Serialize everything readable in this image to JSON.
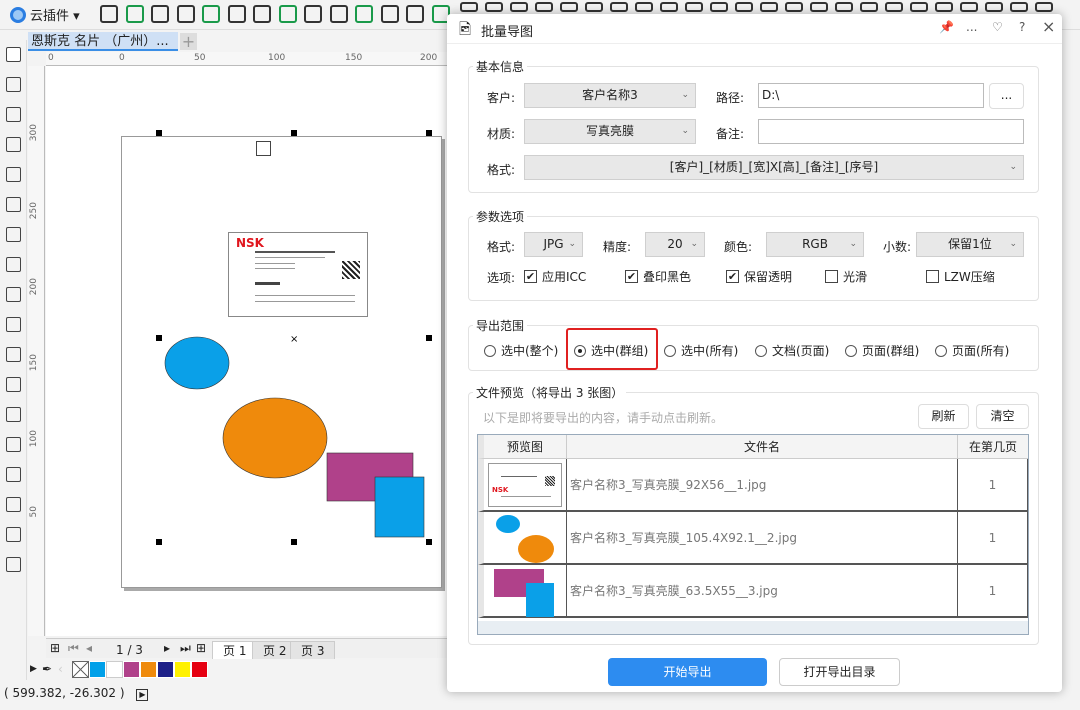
{
  "app": {
    "plugin_menu": "云插件 ▾",
    "toolbar_icons": [
      "image-icon",
      "k-logo-icon",
      "node-icon",
      "book-icon",
      "text-frame-icon",
      "text-tool-icon",
      "text-style-icon",
      "artistic-text-icon",
      "frame-icon",
      "replace-icon",
      "grid-icon",
      "select-box-icon",
      "search-icon",
      "pencil-icon"
    ]
  },
  "document": {
    "tab_title": "恩斯克 名片 （广州）...",
    "add_tab": "+"
  },
  "ruler": {
    "h_labels": [
      "0",
      "0",
      "50",
      "100",
      "150",
      "200"
    ],
    "v_labels": [
      "300",
      "250",
      "200",
      "150",
      "100",
      "50"
    ]
  },
  "toolbox": {
    "icons": [
      "pointer-icon",
      "node-edit-icon",
      "crop-icon",
      "zoom-icon",
      "freehand-icon",
      "curve-icon",
      "rectangle-icon",
      "ellipse-icon",
      "polygon-icon",
      "text-icon",
      "line-icon",
      "connector-icon",
      "shadow-icon",
      "fill-icon",
      "eyedropper-icon",
      "interactive-fill-icon",
      "smart-fill-icon",
      "add-icon"
    ]
  },
  "card": {
    "brand": "NSK"
  },
  "shapes": {
    "colors": {
      "blue": "#0aa0e8",
      "orange": "#ef8a0c",
      "purple": "#b0418a"
    }
  },
  "pagenav": {
    "counter": "1 / 3",
    "tabs": [
      "页 1",
      "页 2",
      "页 3"
    ]
  },
  "palette": {
    "colors": [
      "#00a0e9",
      "#ffffff",
      "#b0418a",
      "#ef8a0c",
      "#1d2088",
      "#fff100",
      "#e60012"
    ]
  },
  "status": {
    "coords": "( 599.382, -26.302 )"
  },
  "dialog": {
    "title": "批量导图",
    "title_icons": [
      "pin-icon",
      "more-icon",
      "heart-icon",
      "help-icon",
      "close-icon"
    ],
    "more": "...",
    "help": "?",
    "close": "×",
    "basic": {
      "legend": "基本信息",
      "customer_label": "客户:",
      "customer_value": "客户名称3",
      "path_label": "路径:",
      "path_value": "D:\\",
      "browse": "...",
      "material_label": "材质:",
      "material_value": "写真亮膜",
      "note_label": "备注:",
      "note_value": "",
      "format_label": "格式:",
      "format_value": "[客户]_[材质]_[宽]X[高]_[备注]_[序号]"
    },
    "params": {
      "legend": "参数选项",
      "format_label": "格式:",
      "format_value": "JPG",
      "precision_label": "精度:",
      "precision_value": "20",
      "color_label": "颜色:",
      "color_value": "RGB",
      "decimal_label": "小数:",
      "decimal_value": "保留1位",
      "options_label": "选项:",
      "options": [
        {
          "label": "应用ICC",
          "checked": true
        },
        {
          "label": "叠印黑色",
          "checked": true
        },
        {
          "label": "保留透明",
          "checked": true
        },
        {
          "label": "光滑",
          "checked": false
        },
        {
          "label": "LZW压缩",
          "checked": false
        }
      ]
    },
    "range": {
      "legend": "导出范围",
      "options": [
        "选中(整个)",
        "选中(群组)",
        "选中(所有)",
        "文档(页面)",
        "页面(群组)",
        "页面(所有)"
      ],
      "selected": 1,
      "highlight_color": "#e02020"
    },
    "preview": {
      "legend": "文件预览（将导出 3 张图）",
      "hint": "以下是即将要导出的内容，请手动点击刷新。",
      "refresh": "刷新",
      "clear": "清空",
      "columns": [
        "预览图",
        "文件名",
        "在第几页"
      ],
      "rows": [
        {
          "file": "客户名称3_写真亮膜_92X56__1.jpg",
          "page": "1"
        },
        {
          "file": "客户名称3_写真亮膜_105.4X92.1__2.jpg",
          "page": "1"
        },
        {
          "file": "客户名称3_写真亮膜_63.5X55__3.jpg",
          "page": "1"
        }
      ]
    },
    "start": "开始导出",
    "open_dir": "打开导出目录",
    "accent": "#2d8cf0"
  }
}
